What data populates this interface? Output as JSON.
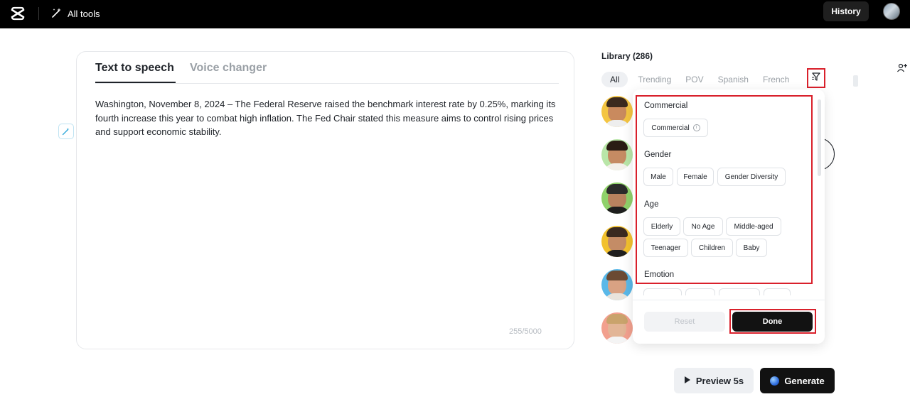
{
  "header": {
    "logo_icon": "capcut-logo-icon",
    "all_tools_label": "All tools",
    "all_tools_icon": "magic-wand-icon",
    "history_label": "History",
    "avatar_icon": "user-avatar"
  },
  "editor": {
    "tabs": [
      {
        "label": "Text to speech",
        "active": true
      },
      {
        "label": "Voice changer",
        "active": false
      }
    ],
    "text": "Washington, November 8, 2024 – The Federal Reserve raised the benchmark interest rate by 0.25%, marking its fourth increase this year to combat high inflation. The Fed Chair stated this measure aims to control rising prices and support economic stability.",
    "char_count": "255/5000",
    "side_tool_icon": "magic-rewrite-icon"
  },
  "library": {
    "title": "Library (286)",
    "chips": [
      "All",
      "Trending",
      "POV",
      "Spanish",
      "French"
    ],
    "active_chip": "All",
    "filter_icon": "filter-icon",
    "voices": [
      {
        "icon": "voice-avatar-1",
        "bg": "#f4c542"
      },
      {
        "icon": "voice-avatar-2",
        "bg": "#b9e6a8"
      },
      {
        "icon": "voice-avatar-3",
        "bg": "#8fd16a"
      },
      {
        "icon": "voice-avatar-4",
        "bg": "#f2c12e"
      },
      {
        "icon": "voice-avatar-5",
        "bg": "#5ab8e8"
      },
      {
        "icon": "voice-avatar-6",
        "bg": "#f2a08e"
      }
    ]
  },
  "filter_panel": {
    "sections": {
      "commercial": {
        "label": "Commercial",
        "options": [
          "Commercial"
        ]
      },
      "gender": {
        "label": "Gender",
        "options": [
          "Male",
          "Female",
          "Gender Diversity"
        ]
      },
      "age": {
        "label": "Age",
        "options": [
          "Elderly",
          "No Age",
          "Middle-aged",
          "Teenager",
          "Children",
          "Baby"
        ]
      },
      "emotion": {
        "label": "Emotion"
      }
    },
    "reset_label": "Reset",
    "done_label": "Done"
  },
  "actions": {
    "preview_label": "Preview 5s",
    "generate_label": "Generate"
  },
  "colors": {
    "highlight": "#d9202b",
    "primary_dark": "#121212"
  }
}
